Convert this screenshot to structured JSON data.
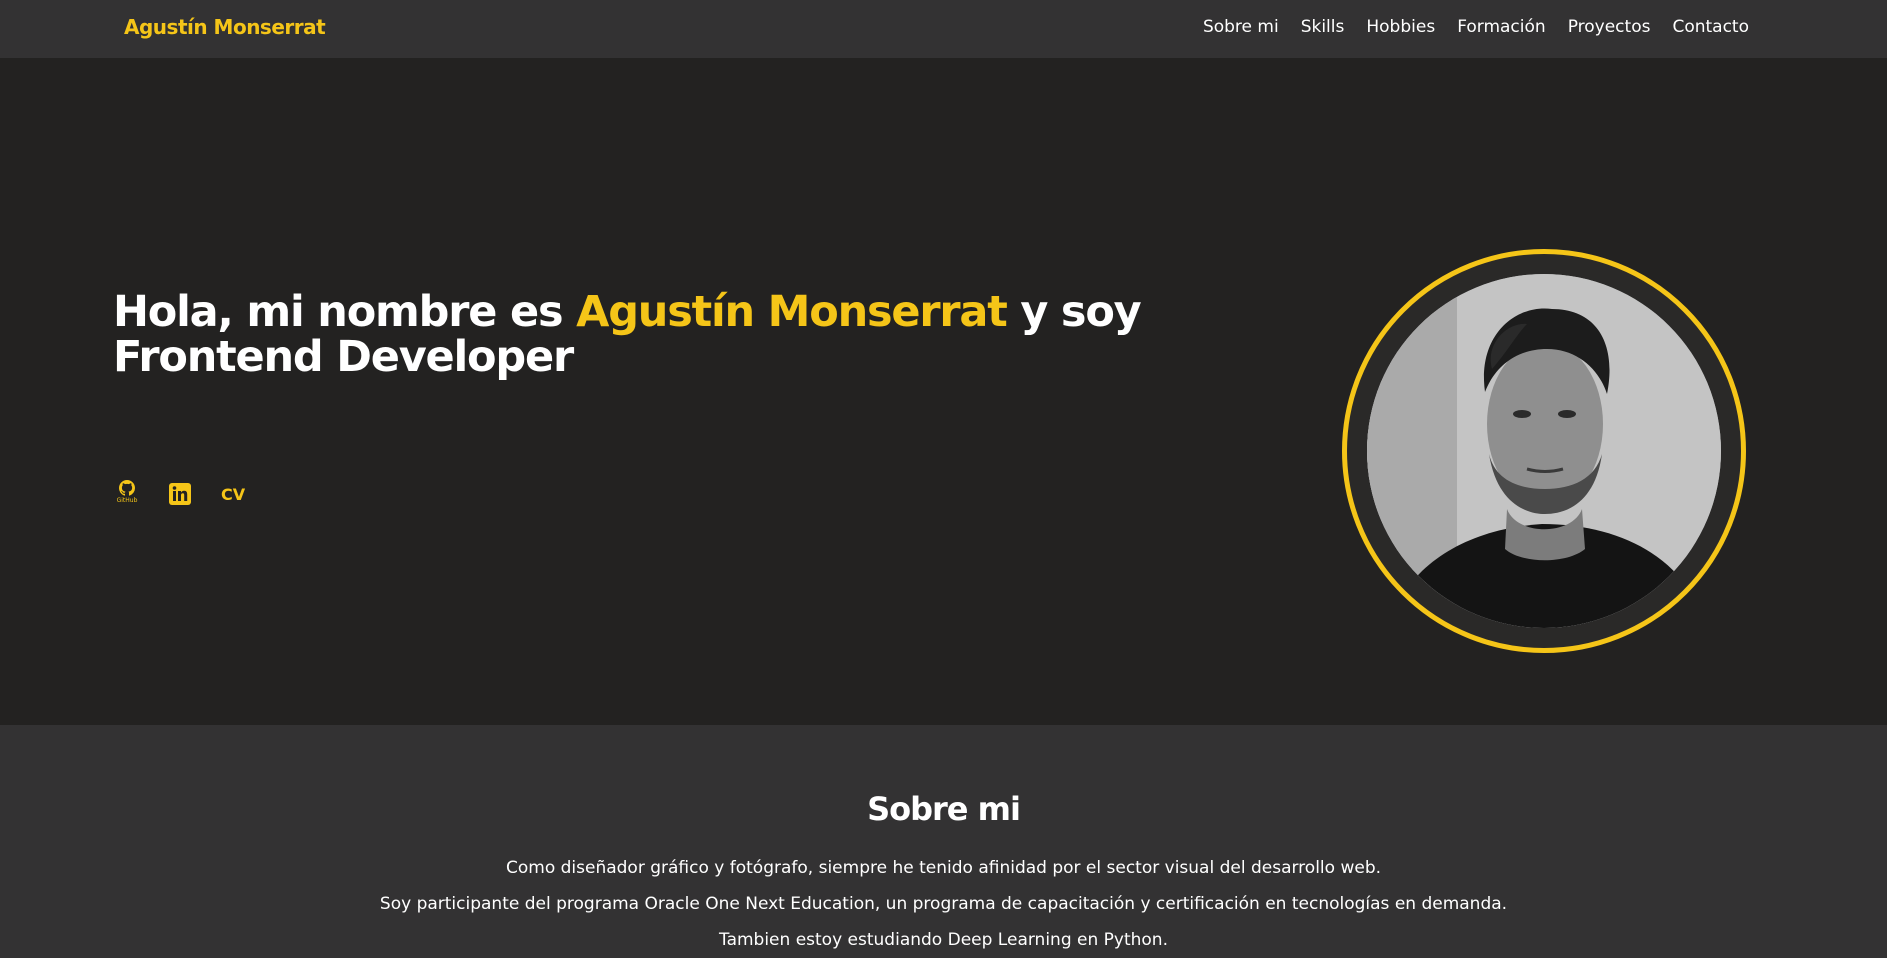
{
  "header": {
    "brand": "Agustín Monserrat",
    "nav": [
      {
        "label": "Sobre mi"
      },
      {
        "label": "Skills"
      },
      {
        "label": "Hobbies"
      },
      {
        "label": "Formación"
      },
      {
        "label": "Proyectos"
      },
      {
        "label": "Contacto"
      }
    ]
  },
  "hero": {
    "title_prefix": "Hola, mi nombre es ",
    "title_name": "Agustín Monserrat",
    "title_suffix": " y soy Frontend Developer",
    "social": {
      "github_icon": "github-icon",
      "github_label": "GitHub",
      "linkedin_icon": "linkedin-icon",
      "cv_label": "CV"
    },
    "avatar_icon": "profile-photo"
  },
  "about": {
    "title": "Sobre mi",
    "lines": [
      "Como diseñador gráfico y fotógrafo, siempre he tenido afinidad por el sector visual del desarrollo web.",
      "Soy participante del programa Oracle One Next Education, un programa de capacitación y certificación en tecnologías en demanda.",
      "Tambien estoy estudiando Deep Learning en Python."
    ]
  },
  "colors": {
    "accent": "#f5c518",
    "nav_bg": "#333233",
    "hero_bg": "#232221",
    "about_bg": "#333233",
    "text": "#ffffff"
  }
}
